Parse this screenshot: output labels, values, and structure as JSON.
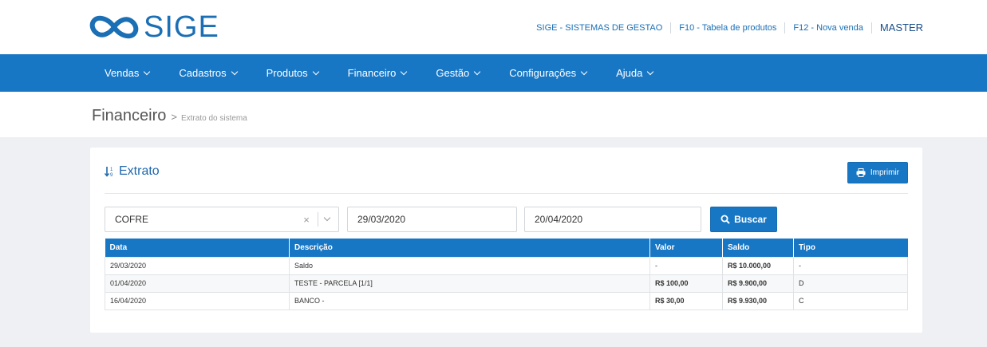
{
  "brand": {
    "name": "SIGE",
    "logo_icon": "infinity-logo-icon",
    "color": "#1a6fb5"
  },
  "top_links": {
    "company": "SIGE - SISTEMAS DE GESTAO",
    "f10": "F10 - Tabela de produtos",
    "f12": "F12 - Nova venda",
    "user": "MASTER"
  },
  "nav": {
    "items": [
      {
        "label": "Vendas"
      },
      {
        "label": "Cadastros"
      },
      {
        "label": "Produtos"
      },
      {
        "label": "Financeiro"
      },
      {
        "label": "Gestão"
      },
      {
        "label": "Configurações"
      },
      {
        "label": "Ajuda"
      }
    ],
    "background": "#1877c5"
  },
  "breadcrumb": {
    "title": "Financeiro",
    "separator": ">",
    "subtitle": "Extrato do sistema"
  },
  "panel": {
    "title": "Extrato",
    "title_icon": "sort-numeric-icon",
    "print_label": "Imprimir",
    "print_icon": "print-icon"
  },
  "filters": {
    "account": "COFRE",
    "date_start": "29/03/2020",
    "date_end": "20/04/2020",
    "search_label": "Buscar",
    "search_icon": "search-icon"
  },
  "table": {
    "headers": [
      "Data",
      "Descrição",
      "Valor",
      "Saldo",
      "Tipo"
    ],
    "rows": [
      {
        "data": "29/03/2020",
        "descricao": "Saldo",
        "valor": "-",
        "saldo": "R$ 10.000,00",
        "tipo": "-"
      },
      {
        "data": "01/04/2020",
        "descricao": "TESTE - PARCELA [1/1]",
        "valor": "R$ 100,00",
        "saldo": "R$ 9.900,00",
        "tipo": "D"
      },
      {
        "data": "16/04/2020",
        "descricao": "BANCO -",
        "valor": "R$ 30,00",
        "saldo": "R$ 9.930,00",
        "tipo": "C"
      }
    ],
    "colors": {
      "debit": "#d33a3a",
      "credit": "#2a9a8a"
    }
  }
}
